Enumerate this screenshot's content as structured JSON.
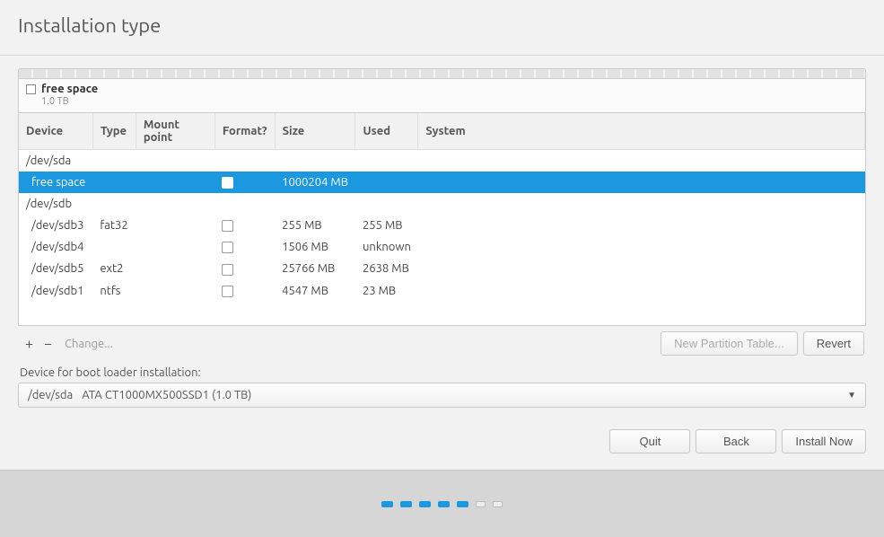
{
  "title": "Installation type",
  "legend": {
    "name": "free space",
    "size": "1.0 TB"
  },
  "columns": {
    "device": "Device",
    "type": "Type",
    "mount": "Mount point",
    "format": "Format?",
    "size": "Size",
    "used": "Used",
    "system": "System"
  },
  "rows": [
    {
      "kind": "disk",
      "device": "/dev/sda"
    },
    {
      "kind": "part",
      "device": "free space",
      "type": "",
      "format": true,
      "size": "1000204 MB",
      "used": "",
      "selected": true
    },
    {
      "kind": "disk",
      "device": "/dev/sdb"
    },
    {
      "kind": "part",
      "device": "/dev/sdb3",
      "type": "fat32",
      "format": true,
      "size": "255 MB",
      "used": "255 MB"
    },
    {
      "kind": "part",
      "device": "/dev/sdb4",
      "type": "",
      "format": true,
      "size": "1506 MB",
      "used": "unknown"
    },
    {
      "kind": "part",
      "device": "/dev/sdb5",
      "type": "ext2",
      "format": true,
      "size": "25766 MB",
      "used": "2638 MB"
    },
    {
      "kind": "part",
      "device": "/dev/sdb1",
      "type": "ntfs",
      "format": true,
      "size": "4547 MB",
      "used": "23 MB"
    }
  ],
  "toolbar": {
    "add": "+",
    "remove": "−",
    "change": "Change...",
    "new_table": "New Partition Table...",
    "revert": "Revert"
  },
  "bootloader": {
    "label": "Device for boot loader installation:",
    "selected_device": "/dev/sda",
    "selected_desc": "ATA CT1000MX500SSD1 (1.0 TB)"
  },
  "nav": {
    "quit": "Quit",
    "back": "Back",
    "install": "Install Now"
  },
  "progress": {
    "total": 7,
    "current": 5
  }
}
